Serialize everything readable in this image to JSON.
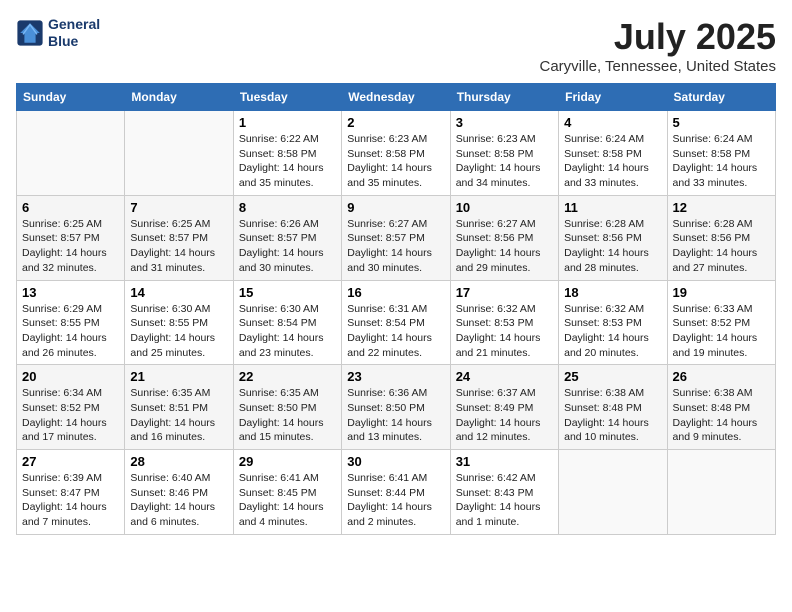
{
  "header": {
    "logo_line1": "General",
    "logo_line2": "Blue",
    "month": "July 2025",
    "location": "Caryville, Tennessee, United States"
  },
  "days_of_week": [
    "Sunday",
    "Monday",
    "Tuesday",
    "Wednesday",
    "Thursday",
    "Friday",
    "Saturday"
  ],
  "weeks": [
    [
      {
        "day": "",
        "info": ""
      },
      {
        "day": "",
        "info": ""
      },
      {
        "day": "1",
        "info": "Sunrise: 6:22 AM\nSunset: 8:58 PM\nDaylight: 14 hours\nand 35 minutes."
      },
      {
        "day": "2",
        "info": "Sunrise: 6:23 AM\nSunset: 8:58 PM\nDaylight: 14 hours\nand 35 minutes."
      },
      {
        "day": "3",
        "info": "Sunrise: 6:23 AM\nSunset: 8:58 PM\nDaylight: 14 hours\nand 34 minutes."
      },
      {
        "day": "4",
        "info": "Sunrise: 6:24 AM\nSunset: 8:58 PM\nDaylight: 14 hours\nand 33 minutes."
      },
      {
        "day": "5",
        "info": "Sunrise: 6:24 AM\nSunset: 8:58 PM\nDaylight: 14 hours\nand 33 minutes."
      }
    ],
    [
      {
        "day": "6",
        "info": "Sunrise: 6:25 AM\nSunset: 8:57 PM\nDaylight: 14 hours\nand 32 minutes."
      },
      {
        "day": "7",
        "info": "Sunrise: 6:25 AM\nSunset: 8:57 PM\nDaylight: 14 hours\nand 31 minutes."
      },
      {
        "day": "8",
        "info": "Sunrise: 6:26 AM\nSunset: 8:57 PM\nDaylight: 14 hours\nand 30 minutes."
      },
      {
        "day": "9",
        "info": "Sunrise: 6:27 AM\nSunset: 8:57 PM\nDaylight: 14 hours\nand 30 minutes."
      },
      {
        "day": "10",
        "info": "Sunrise: 6:27 AM\nSunset: 8:56 PM\nDaylight: 14 hours\nand 29 minutes."
      },
      {
        "day": "11",
        "info": "Sunrise: 6:28 AM\nSunset: 8:56 PM\nDaylight: 14 hours\nand 28 minutes."
      },
      {
        "day": "12",
        "info": "Sunrise: 6:28 AM\nSunset: 8:56 PM\nDaylight: 14 hours\nand 27 minutes."
      }
    ],
    [
      {
        "day": "13",
        "info": "Sunrise: 6:29 AM\nSunset: 8:55 PM\nDaylight: 14 hours\nand 26 minutes."
      },
      {
        "day": "14",
        "info": "Sunrise: 6:30 AM\nSunset: 8:55 PM\nDaylight: 14 hours\nand 25 minutes."
      },
      {
        "day": "15",
        "info": "Sunrise: 6:30 AM\nSunset: 8:54 PM\nDaylight: 14 hours\nand 23 minutes."
      },
      {
        "day": "16",
        "info": "Sunrise: 6:31 AM\nSunset: 8:54 PM\nDaylight: 14 hours\nand 22 minutes."
      },
      {
        "day": "17",
        "info": "Sunrise: 6:32 AM\nSunset: 8:53 PM\nDaylight: 14 hours\nand 21 minutes."
      },
      {
        "day": "18",
        "info": "Sunrise: 6:32 AM\nSunset: 8:53 PM\nDaylight: 14 hours\nand 20 minutes."
      },
      {
        "day": "19",
        "info": "Sunrise: 6:33 AM\nSunset: 8:52 PM\nDaylight: 14 hours\nand 19 minutes."
      }
    ],
    [
      {
        "day": "20",
        "info": "Sunrise: 6:34 AM\nSunset: 8:52 PM\nDaylight: 14 hours\nand 17 minutes."
      },
      {
        "day": "21",
        "info": "Sunrise: 6:35 AM\nSunset: 8:51 PM\nDaylight: 14 hours\nand 16 minutes."
      },
      {
        "day": "22",
        "info": "Sunrise: 6:35 AM\nSunset: 8:50 PM\nDaylight: 14 hours\nand 15 minutes."
      },
      {
        "day": "23",
        "info": "Sunrise: 6:36 AM\nSunset: 8:50 PM\nDaylight: 14 hours\nand 13 minutes."
      },
      {
        "day": "24",
        "info": "Sunrise: 6:37 AM\nSunset: 8:49 PM\nDaylight: 14 hours\nand 12 minutes."
      },
      {
        "day": "25",
        "info": "Sunrise: 6:38 AM\nSunset: 8:48 PM\nDaylight: 14 hours\nand 10 minutes."
      },
      {
        "day": "26",
        "info": "Sunrise: 6:38 AM\nSunset: 8:48 PM\nDaylight: 14 hours\nand 9 minutes."
      }
    ],
    [
      {
        "day": "27",
        "info": "Sunrise: 6:39 AM\nSunset: 8:47 PM\nDaylight: 14 hours\nand 7 minutes."
      },
      {
        "day": "28",
        "info": "Sunrise: 6:40 AM\nSunset: 8:46 PM\nDaylight: 14 hours\nand 6 minutes."
      },
      {
        "day": "29",
        "info": "Sunrise: 6:41 AM\nSunset: 8:45 PM\nDaylight: 14 hours\nand 4 minutes."
      },
      {
        "day": "30",
        "info": "Sunrise: 6:41 AM\nSunset: 8:44 PM\nDaylight: 14 hours\nand 2 minutes."
      },
      {
        "day": "31",
        "info": "Sunrise: 6:42 AM\nSunset: 8:43 PM\nDaylight: 14 hours\nand 1 minute."
      },
      {
        "day": "",
        "info": ""
      },
      {
        "day": "",
        "info": ""
      }
    ]
  ]
}
